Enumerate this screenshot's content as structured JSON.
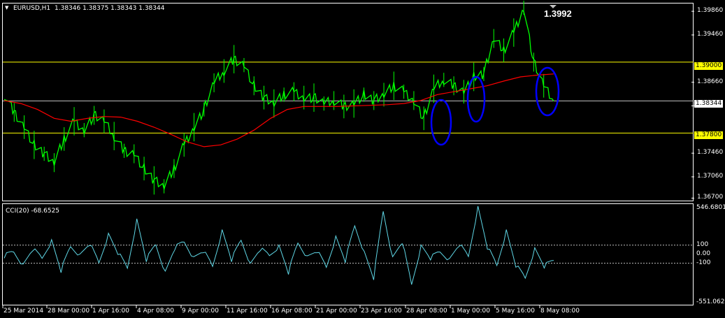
{
  "header": {
    "symbol_label": "EURUSD,H1",
    "ohlc": "1.38346 1.38375 1.38343 1.38344",
    "menu_glyph": "▼"
  },
  "annotation": {
    "peak_label": "1.3992"
  },
  "price_axis": {
    "labels": [
      "1.39860",
      "1.39460",
      "1.38660",
      "1.38260",
      "1.37460",
      "1.37060",
      "1.36700"
    ],
    "hline_upper": {
      "label": "1.39000",
      "color": "#ffff00"
    },
    "hline_lower": {
      "label": "1.37800",
      "color": "#ffff00"
    },
    "current_price": "1.38344"
  },
  "indicator": {
    "title": "CCI(20) -68.6525",
    "axis_labels": [
      "546.6801",
      "100",
      "0.00",
      "-100",
      "-551.0629"
    ]
  },
  "time_axis": {
    "labels": [
      "25 Mar 2014",
      "28 Mar 00:00",
      "1 Apr 16:00",
      "4 Apr 08:00",
      "9 Apr 00:00",
      "11 Apr 16:00",
      "16 Apr 08:00",
      "21 Apr 00:00",
      "23 Apr 16:00",
      "28 Apr 08:00",
      "1 May 00:00",
      "5 May 16:00",
      "8 May 08:00"
    ]
  },
  "colors": {
    "background": "#000000",
    "price_line": "#00ff00",
    "moving_average": "#ff0000",
    "cci_line": "#5fd7e6",
    "hline": "#ffff00",
    "current_price_line": "#c0c0c0",
    "ellipse": "#0000ff",
    "panel_border": "#ffffff"
  },
  "chart_data": {
    "type": "line",
    "series": [
      {
        "values": [
          1.3845,
          1.3815,
          1.379,
          1.376,
          1.3745,
          1.373,
          1.377,
          1.38,
          1.3785,
          1.381,
          1.38,
          1.3775,
          1.375,
          1.3745,
          1.372,
          1.37,
          1.369,
          1.372,
          1.376,
          1.379,
          1.382,
          1.3865,
          1.3885,
          1.3905,
          1.3895,
          1.386,
          1.384,
          1.383,
          1.3845,
          1.385,
          1.384,
          1.384,
          1.383,
          1.3835,
          1.3825,
          1.383,
          1.3845,
          1.3835,
          1.3845,
          1.386,
          1.385,
          1.3835,
          1.3805,
          1.3855,
          1.387,
          1.386,
          1.385,
          1.3875,
          1.388,
          1.394,
          1.392,
          1.395,
          1.3992,
          1.39,
          1.386,
          1.3834
        ]
      },
      {
        "values": [
          1.3835,
          1.383,
          1.382,
          1.3805,
          1.38,
          1.3805,
          1.3808,
          1.3807,
          1.38,
          1.379,
          1.3778,
          1.3765,
          1.3757,
          1.376,
          1.377,
          1.3785,
          1.3805,
          1.382,
          1.3825,
          1.3825,
          1.3825,
          1.3826,
          1.3827,
          1.3828,
          1.383,
          1.3835,
          1.3845,
          1.385,
          1.3855,
          1.386,
          1.3868,
          1.3875,
          1.3878,
          1.388
        ]
      }
    ],
    "x": [
      "25 Mar 2014",
      "28 Mar 00:00",
      "1 Apr 16:00",
      "4 Apr 08:00",
      "9 Apr 00:00",
      "11 Apr 16:00",
      "16 Apr 08:00",
      "21 Apr 00:00",
      "23 Apr 16:00",
      "28 Apr 08:00",
      "1 May 00:00",
      "5 May 16:00",
      "8 May 08:00"
    ],
    "ylim": [
      1.3667,
      1.3998
    ],
    "hlines": [
      1.39,
      1.378,
      1.38344
    ],
    "peak_value": 1.3992,
    "indicator": {
      "name": "CCI(20)",
      "last_value": -68.6525,
      "ylim": [
        -551.0629,
        546.6801
      ],
      "levels": [
        100,
        0,
        -100
      ],
      "values": [
        -20,
        30,
        -120,
        60,
        -40,
        150,
        -180,
        90,
        -10,
        120,
        -90,
        220,
        20,
        -150,
        380,
        -60,
        110,
        -200,
        70,
        140,
        -40,
        40,
        -130,
        260,
        -60,
        160,
        -110,
        60,
        -10,
        90,
        -200,
        130,
        -30,
        40,
        -140,
        190,
        -70,
        320,
        20,
        -260,
        480,
        -40,
        140,
        -330,
        90,
        -40,
        30,
        -60,
        110,
        -20,
        520,
        80,
        -120,
        260,
        -120,
        -260,
        60,
        -130,
        -68.65
      ]
    }
  }
}
